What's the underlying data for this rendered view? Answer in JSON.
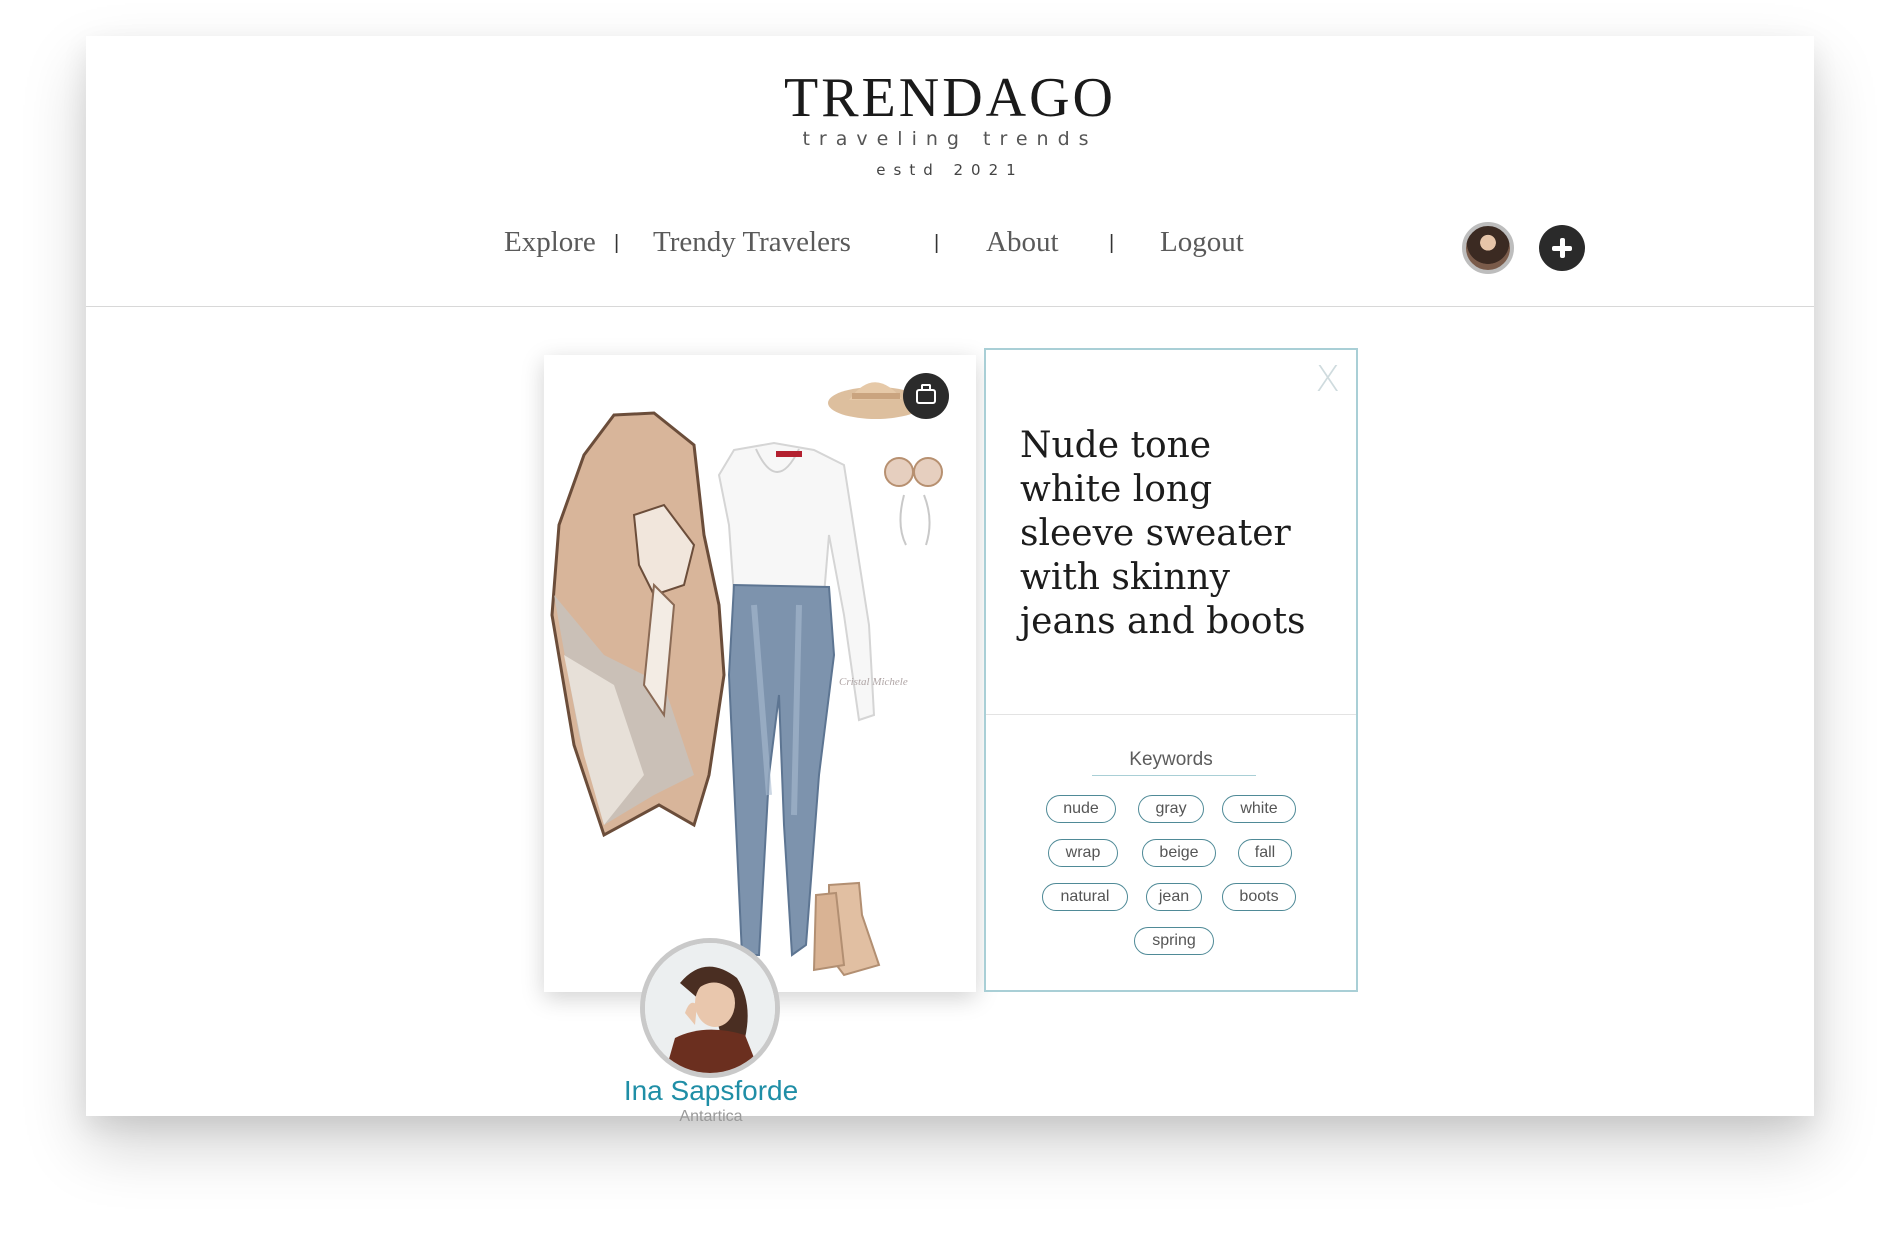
{
  "brand": {
    "title": "TRENDAGO",
    "tagline": "traveling trends",
    "established": "estd 2021"
  },
  "nav": {
    "items": [
      {
        "label": "Explore"
      },
      {
        "label": "Trendy Travelers"
      },
      {
        "label": "About"
      },
      {
        "label": "Logout"
      }
    ],
    "separator": "|"
  },
  "header_actions": {
    "avatar_icon": "user-avatar-icon",
    "add_icon": "plus-icon"
  },
  "post": {
    "image_watermark": "Cristal Michele",
    "save_icon": "suitcase-icon",
    "title": "Nude tone white long sleeve sweater with skinny jeans and boots",
    "close_label": "X",
    "keywords_label": "Keywords",
    "keywords": [
      "nude",
      "gray",
      "white",
      "wrap",
      "beige",
      "fall",
      "natural",
      "jean",
      "boots",
      "spring"
    ]
  },
  "author": {
    "name": "Ina Sapsforde",
    "location": "Antartica"
  },
  "colors": {
    "accent": "#1f8ea6",
    "panel_border": "#a9cfd6",
    "chip_border": "#4f8a97",
    "dark_button": "#2a2a2a"
  }
}
